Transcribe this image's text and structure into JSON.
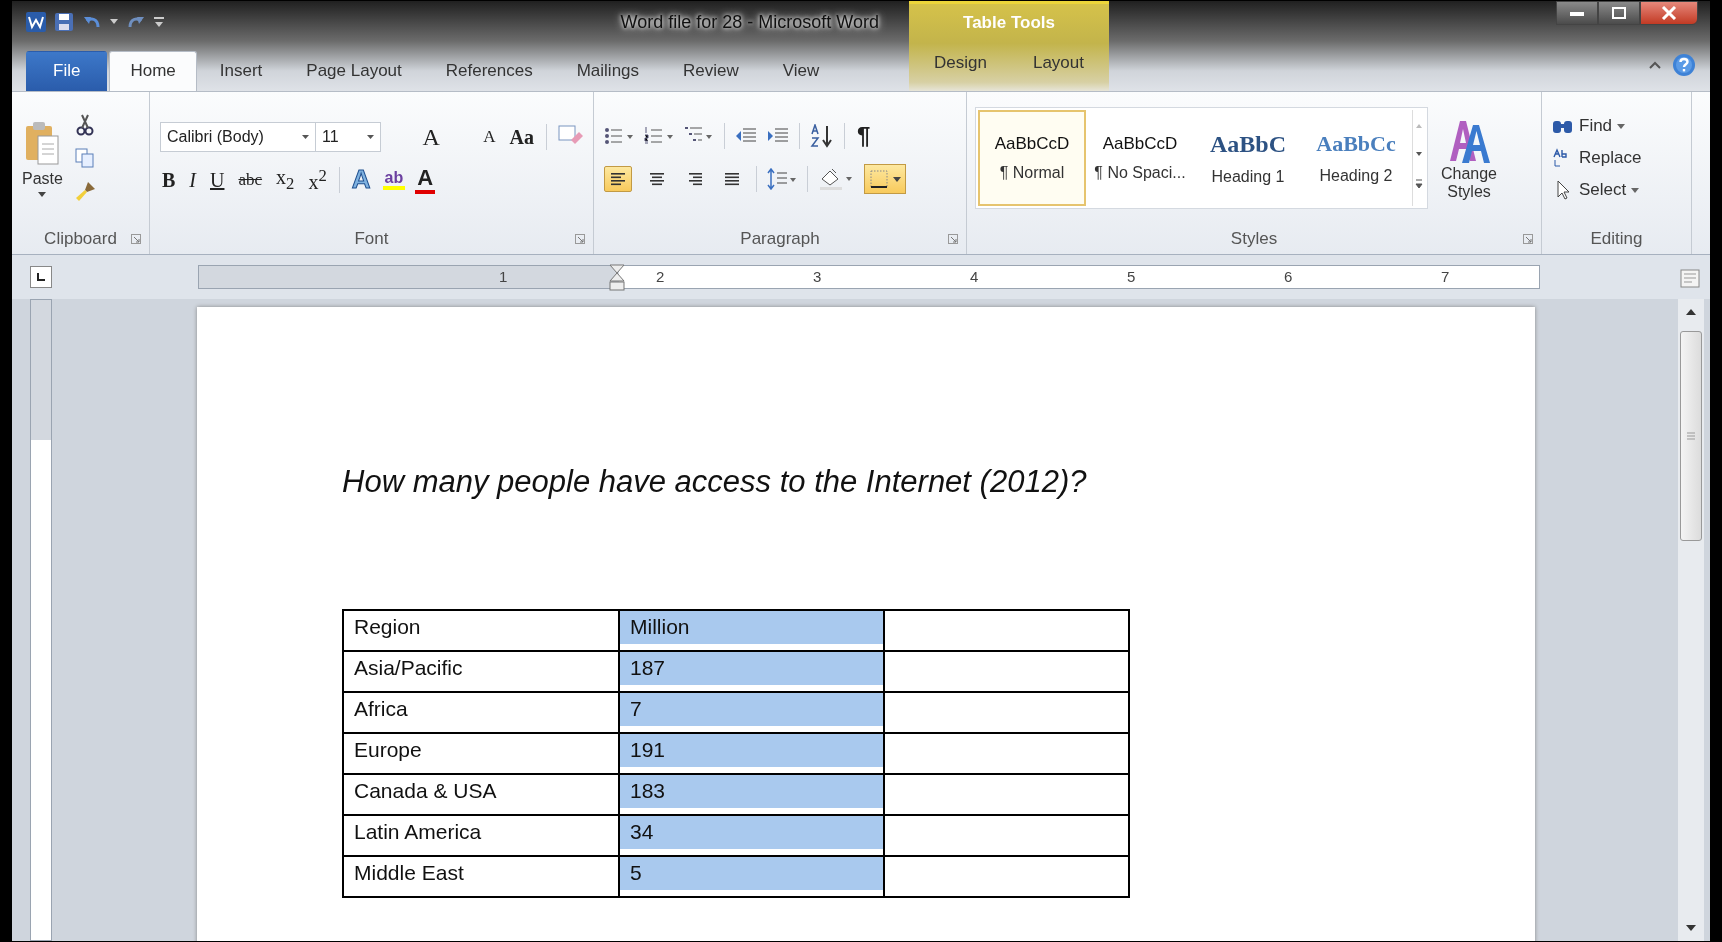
{
  "window": {
    "title": "Word file for 28  -  Microsoft Word",
    "contextual_title": "Table Tools"
  },
  "tabs": [
    {
      "label": "File",
      "kind": "file",
      "selected": false
    },
    {
      "label": "Home",
      "kind": "main",
      "selected": true
    },
    {
      "label": "Insert",
      "kind": "main",
      "selected": false
    },
    {
      "label": "Page Layout",
      "kind": "main",
      "selected": false
    },
    {
      "label": "References",
      "kind": "main",
      "selected": false
    },
    {
      "label": "Mailings",
      "kind": "main",
      "selected": false
    },
    {
      "label": "Review",
      "kind": "main",
      "selected": false
    },
    {
      "label": "View",
      "kind": "main",
      "selected": false
    },
    {
      "label": "Design",
      "kind": "contextual",
      "selected": false
    },
    {
      "label": "Layout",
      "kind": "contextual",
      "selected": false
    }
  ],
  "clipboard": {
    "paste": "Paste",
    "label": "Clipboard"
  },
  "font": {
    "name": "Calibri (Body)",
    "size": "11",
    "label": "Font",
    "size_buttons": [
      {
        "label": "A",
        "kind": "grow"
      },
      {
        "label": "A",
        "kind": "shrink"
      },
      {
        "label": "Aa",
        "kind": "case"
      }
    ],
    "format_buttons": [
      {
        "label": "B",
        "kind": "bold"
      },
      {
        "label": "I",
        "kind": "italic"
      },
      {
        "label": "U",
        "kind": "underline"
      },
      {
        "label": "abc",
        "kind": "strike"
      },
      {
        "label": "x$_{2}$",
        "kind": "script"
      },
      {
        "label": "x$^{2}$",
        "kind": "script"
      }
    ],
    "color_buttons": [
      {
        "label": "A",
        "kind": "effect",
        "color": "#7fb2e0"
      },
      {
        "label": "ab",
        "kind": "highlight",
        "color": "#ffff00"
      },
      {
        "label": "A",
        "kind": "color",
        "color": "#e00000"
      }
    ]
  },
  "paragraph": {
    "label": "Paragraph",
    "show_marks": "¶",
    "alignments": [
      {
        "kind": "left",
        "selected": true
      },
      {
        "kind": "center",
        "selected": false
      },
      {
        "kind": "right",
        "selected": false
      },
      {
        "kind": "justify",
        "selected": false
      }
    ],
    "borders": {
      "selected": true
    }
  },
  "styles": {
    "label": "Styles",
    "change_styles": "Change Styles",
    "items": [
      {
        "preview": "AaBbCcD",
        "name": "¶ Normal",
        "kind": "body",
        "selected": true
      },
      {
        "preview": "AaBbCcD",
        "name": "¶ No Spaci...",
        "kind": "body",
        "selected": false
      },
      {
        "preview": "AaBbC",
        "name": "Heading 1",
        "kind": "heading1",
        "selected": false
      },
      {
        "preview": "AaBbCc",
        "name": "Heading 2",
        "kind": "heading2",
        "selected": false
      }
    ]
  },
  "editing": {
    "label": "Editing",
    "items": [
      {
        "label": "Find",
        "kind": "find"
      },
      {
        "label": "Replace",
        "kind": "replace"
      },
      {
        "label": "Select",
        "kind": "select"
      }
    ]
  },
  "ruler": {
    "numbers": [
      "1",
      "2",
      "3",
      "4",
      "5",
      "6",
      "7"
    ]
  },
  "document": {
    "heading": "How many people have access to the Internet (2012)?",
    "table": {
      "rows": [
        {
          "cells": [
            {
              "text": "Region",
              "selected": false
            },
            {
              "text": "Million",
              "selected": true
            }
          ]
        },
        {
          "cells": [
            {
              "text": "Asia/Pacific",
              "selected": false
            },
            {
              "text": "187",
              "selected": true
            }
          ]
        },
        {
          "cells": [
            {
              "text": "Africa",
              "selected": false
            },
            {
              "text": "7",
              "selected": true
            }
          ]
        },
        {
          "cells": [
            {
              "text": "Europe",
              "selected": false
            },
            {
              "text": "191",
              "selected": true
            }
          ]
        },
        {
          "cells": [
            {
              "text": "Canada & USA",
              "selected": false
            },
            {
              "text": "183",
              "selected": true
            }
          ]
        },
        {
          "cells": [
            {
              "text": "Latin America",
              "selected": false
            },
            {
              "text": "34",
              "selected": true
            }
          ]
        },
        {
          "cells": [
            {
              "text": "Middle East",
              "selected": false
            },
            {
              "text": "5",
              "selected": true
            }
          ]
        }
      ]
    }
  }
}
